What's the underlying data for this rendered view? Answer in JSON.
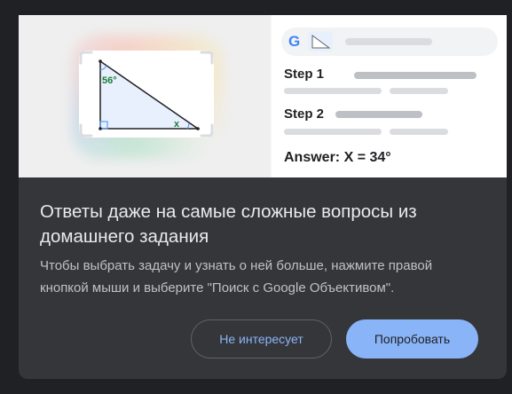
{
  "hero": {
    "triangle": {
      "angle_label": "56°",
      "unknown_label": "x"
    },
    "search": {
      "logo_letter": "G",
      "logo_color": "#4285f4"
    },
    "steps": [
      {
        "label": "Step  1"
      },
      {
        "label": "Step 2"
      }
    ],
    "answer": "Answer: X = 34°"
  },
  "dialog": {
    "title": "Ответы даже на самые сложные вопросы из домашнего задания",
    "description": "Чтобы выбрать задачу и узнать о ней больше, нажмите правой кнопкой мыши и выберите \"Поиск с Google Объективом\".",
    "dismiss_label": "Не интересует",
    "try_label": "Попробовать"
  },
  "colors": {
    "background": "#202124",
    "card": "#35363a",
    "accent": "#8ab4f8",
    "title_text": "#e8eaed",
    "body_text": "#bdc1c6"
  }
}
